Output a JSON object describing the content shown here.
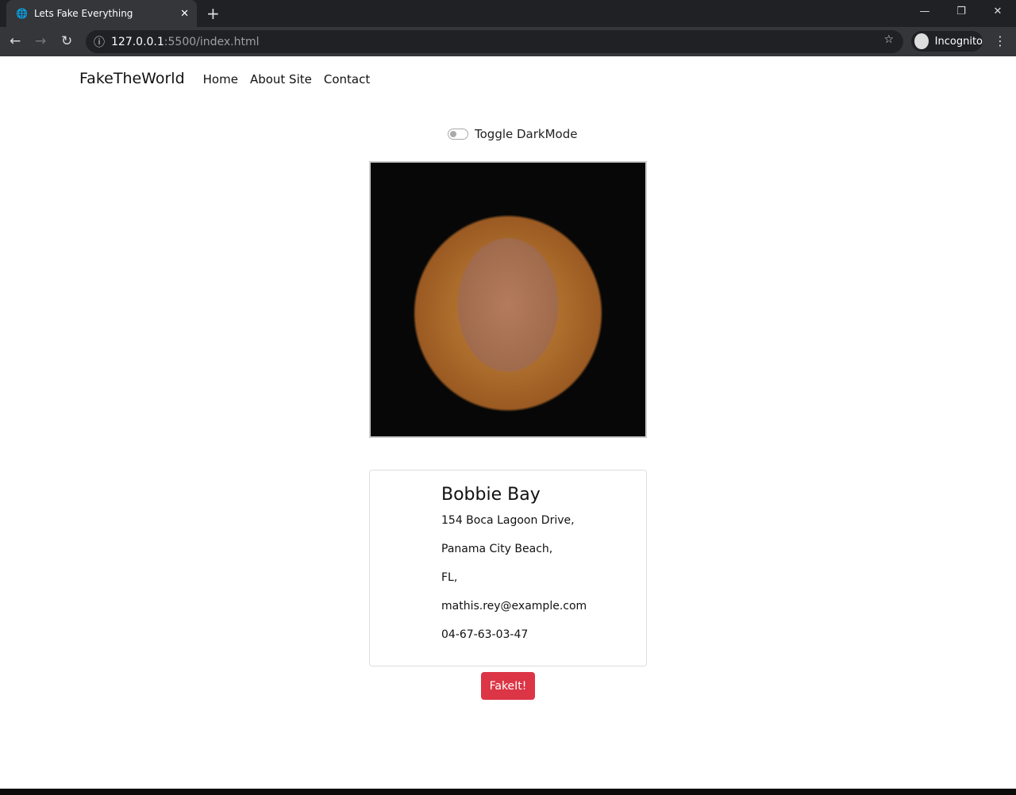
{
  "browser": {
    "tab_title": "Lets Fake Everything",
    "url_host": "127.0.0.1",
    "url_path": ":5500/index.html",
    "incognito_label": "Incognito"
  },
  "nav": {
    "brand": "FakeTheWorld",
    "links": [
      "Home",
      "About Site",
      "Contact"
    ]
  },
  "toggle": {
    "label": "Toggle DarkMode",
    "checked": false
  },
  "person": {
    "name": "Bobbie Bay",
    "street": "154 Boca Lagoon Drive,",
    "city": "Panama City Beach,",
    "state": "FL,",
    "email": "mathis.rey@example.com",
    "phone": "04-67-63-03-47"
  },
  "button": {
    "label": "FakeIt!"
  },
  "colors": {
    "button": "#dc3545"
  }
}
